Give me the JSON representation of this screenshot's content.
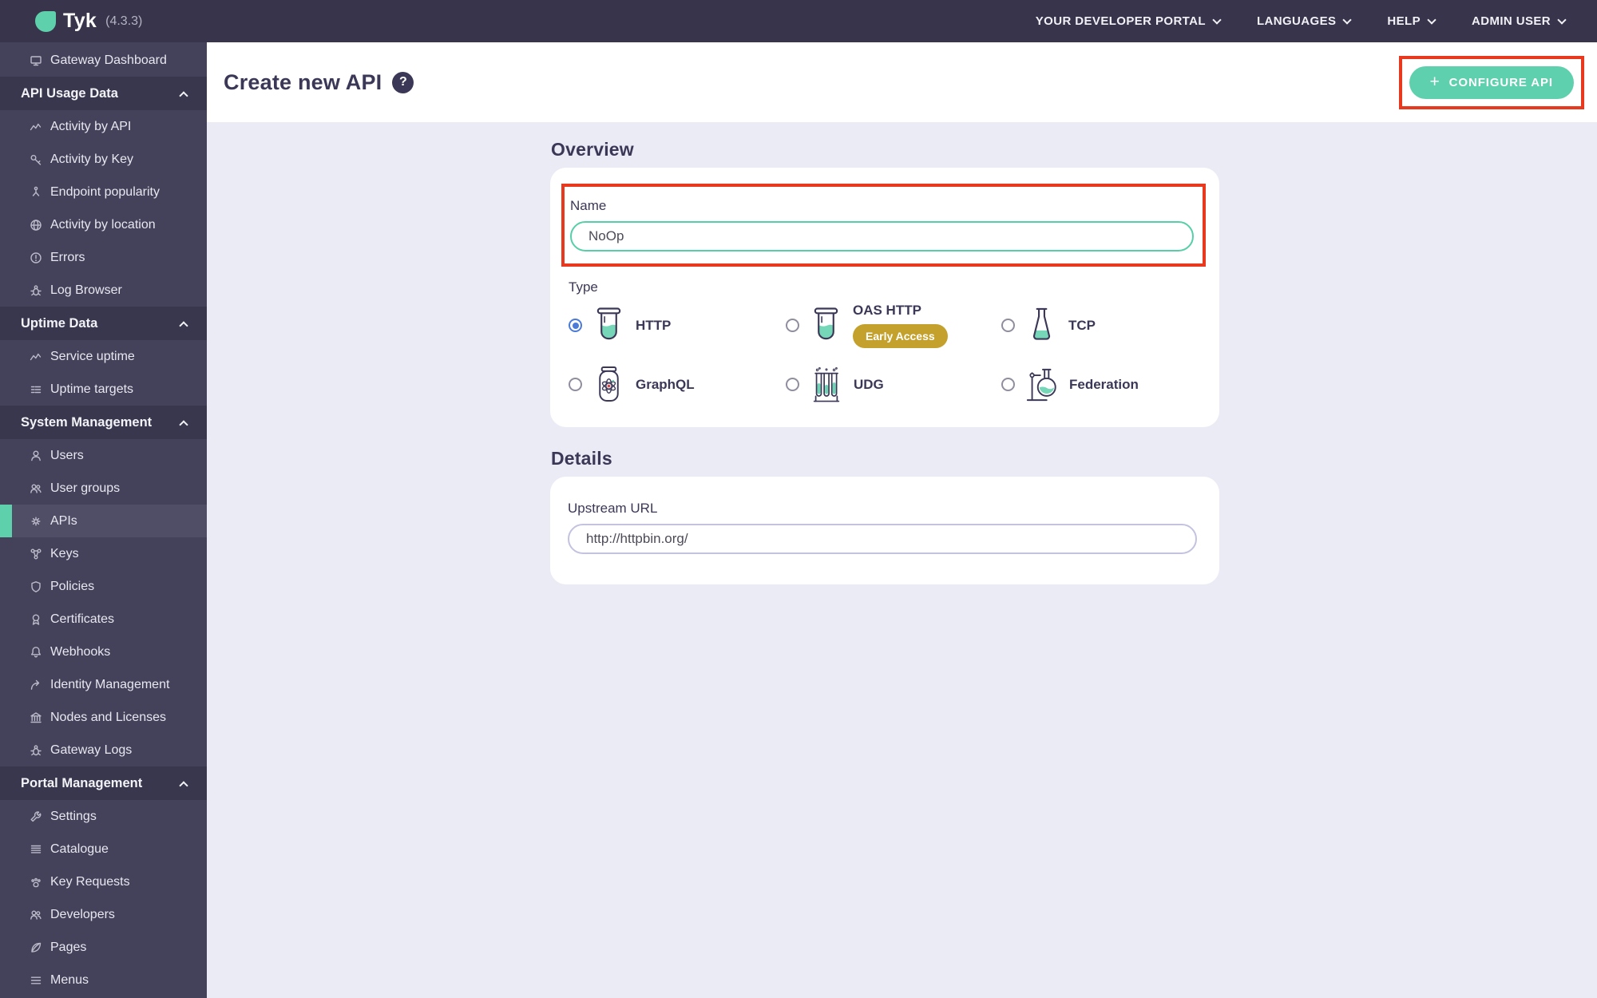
{
  "topbar": {
    "logo_text": "Tyk",
    "version": "(4.3.3)",
    "menus": [
      {
        "label": "YOUR DEVELOPER PORTAL"
      },
      {
        "label": "LANGUAGES"
      },
      {
        "label": "HELP"
      },
      {
        "label": "ADMIN USER"
      }
    ]
  },
  "sidebar": {
    "items": [
      {
        "type": "link",
        "label": "Gateway Dashboard",
        "icon": "monitor-icon"
      },
      {
        "type": "header",
        "label": "API Usage Data"
      },
      {
        "type": "link",
        "label": "Activity by API",
        "icon": "activity-icon"
      },
      {
        "type": "link",
        "label": "Activity by Key",
        "icon": "key-icon"
      },
      {
        "type": "link",
        "label": "Endpoint popularity",
        "icon": "branch-icon"
      },
      {
        "type": "link",
        "label": "Activity by location",
        "icon": "globe-icon"
      },
      {
        "type": "link",
        "label": "Errors",
        "icon": "error-icon"
      },
      {
        "type": "link",
        "label": "Log Browser",
        "icon": "bug-icon"
      },
      {
        "type": "header",
        "label": "Uptime Data"
      },
      {
        "type": "link",
        "label": "Service uptime",
        "icon": "activity-icon"
      },
      {
        "type": "link",
        "label": "Uptime targets",
        "icon": "list-icon"
      },
      {
        "type": "header",
        "label": "System Management"
      },
      {
        "type": "link",
        "label": "Users",
        "icon": "user-icon"
      },
      {
        "type": "link",
        "label": "User groups",
        "icon": "user-group-icon"
      },
      {
        "type": "link",
        "label": "APIs",
        "icon": "gears-icon",
        "active": true
      },
      {
        "type": "link",
        "label": "Keys",
        "icon": "network-icon"
      },
      {
        "type": "link",
        "label": "Policies",
        "icon": "shield-icon"
      },
      {
        "type": "link",
        "label": "Certificates",
        "icon": "medal-icon"
      },
      {
        "type": "link",
        "label": "Webhooks",
        "icon": "bell-icon"
      },
      {
        "type": "link",
        "label": "Identity Management",
        "icon": "identity-arrow-icon"
      },
      {
        "type": "link",
        "label": "Nodes and Licenses",
        "icon": "bank-icon"
      },
      {
        "type": "link",
        "label": "Gateway Logs",
        "icon": "bug-icon"
      },
      {
        "type": "header",
        "label": "Portal Management"
      },
      {
        "type": "link",
        "label": "Settings",
        "icon": "wrench-icon"
      },
      {
        "type": "link",
        "label": "Catalogue",
        "icon": "catalogue-icon"
      },
      {
        "type": "link",
        "label": "Key Requests",
        "icon": "paw-icon"
      },
      {
        "type": "link",
        "label": "Developers",
        "icon": "user-group-icon"
      },
      {
        "type": "link",
        "label": "Pages",
        "icon": "leaf-icon"
      },
      {
        "type": "link",
        "label": "Menus",
        "icon": "menu-icon"
      }
    ]
  },
  "header": {
    "title": "Create new API",
    "help_glyph": "?",
    "plus_glyph": "+",
    "configure_button": "CONFIGURE API"
  },
  "overview": {
    "heading": "Overview",
    "name_label": "Name",
    "name_value": "NoOp",
    "type_label": "Type",
    "types": [
      {
        "label": "HTTP",
        "icon": "beaker-icon",
        "selected": true
      },
      {
        "label": "OAS HTTP",
        "icon": "beaker-icon",
        "selected": false,
        "badge": "Early Access"
      },
      {
        "label": "TCP",
        "icon": "flask-icon",
        "selected": false
      },
      {
        "label": "GraphQL",
        "icon": "atom-jar-icon",
        "selected": false
      },
      {
        "label": "UDG",
        "icon": "test-tubes-icon",
        "selected": false
      },
      {
        "label": "Federation",
        "icon": "round-flask-icon",
        "selected": false
      }
    ]
  },
  "details": {
    "heading": "Details",
    "upstream_label": "Upstream URL",
    "upstream_value": "http://httpbin.org/"
  },
  "colors": {
    "accent_teal": "#5ed0ac",
    "annotation_red": "#e8391f",
    "badge_gold": "#c4a12d",
    "radio_blue": "#4a7bd9",
    "topbar_bg": "#37344b",
    "sidebar_bg": "#44425a",
    "content_bg": "#ebebf6",
    "heading_text": "#3b3857"
  }
}
